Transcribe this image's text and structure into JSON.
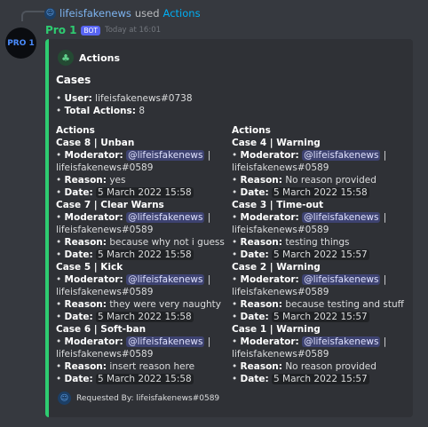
{
  "reply": {
    "username": "lifeisfakenews",
    "used": "used",
    "command": "Actions",
    "icon": "user-avatar-icon"
  },
  "message": {
    "avatar_text": "PRO 1",
    "bot_name": "Pro 1",
    "badge": "BOT",
    "timestamp": "Today at 16:01"
  },
  "embed": {
    "color": "#2ecc71",
    "author_name": "Actions",
    "title": "Cases",
    "user_label": "User:",
    "user_value": "lifeisfakenews#0738",
    "total_label": "Total Actions:",
    "total_value": "8",
    "fields": [
      {
        "name": "Actions",
        "cases": [
          {
            "title": "Case 8 | Unban",
            "moderator_mention": "@lifeisfakenews",
            "moderator_tag": "lifeisfakenews#0589",
            "reason": "yes",
            "date": "5 March 2022 15:58"
          },
          {
            "title": "Case 7 | Clear Warns",
            "moderator_mention": "@lifeisfakenews",
            "moderator_tag": "lifeisfakenews#0589",
            "reason": "because why not i guess",
            "date": "5 March 2022 15:58"
          },
          {
            "title": "Case 5 | Kick",
            "moderator_mention": "@lifeisfakenews",
            "moderator_tag": "lifeisfakenews#0589",
            "reason": "they were very naughty",
            "date": "5 March 2022 15:58"
          },
          {
            "title": "Case 6 | Soft-ban",
            "moderator_mention": "@lifeisfakenews",
            "moderator_tag": "lifeisfakenews#0589",
            "reason": "insert reason here",
            "date": "5 March 2022 15:58"
          }
        ]
      },
      {
        "name": "Actions",
        "cases": [
          {
            "title": "Case 4 | Warning",
            "moderator_mention": "@lifeisfakenews",
            "moderator_tag": "lifeisfakenews#0589",
            "reason": "No reason provided",
            "date": "5 March 2022 15:58"
          },
          {
            "title": "Case 3 | Time-out",
            "moderator_mention": "@lifeisfakenews",
            "moderator_tag": "lifeisfakenews#0589",
            "reason": "testing things",
            "date": "5 March 2022 15:57"
          },
          {
            "title": "Case 2 | Warning",
            "moderator_mention": "@lifeisfakenews",
            "moderator_tag": "lifeisfakenews#0589",
            "reason": "because testing and stuff",
            "date": "5 March 2022 15:57"
          },
          {
            "title": "Case 1 | Warning",
            "moderator_mention": "@lifeisfakenews",
            "moderator_tag": "lifeisfakenews#0589",
            "reason": "No reason provided",
            "date": "5 March 2022 15:57"
          }
        ]
      }
    ],
    "labels": {
      "moderator": "Moderator:",
      "reason": "Reason:",
      "date": "Date:"
    },
    "footer": "Requested By: lifeisfakenews#0589"
  }
}
